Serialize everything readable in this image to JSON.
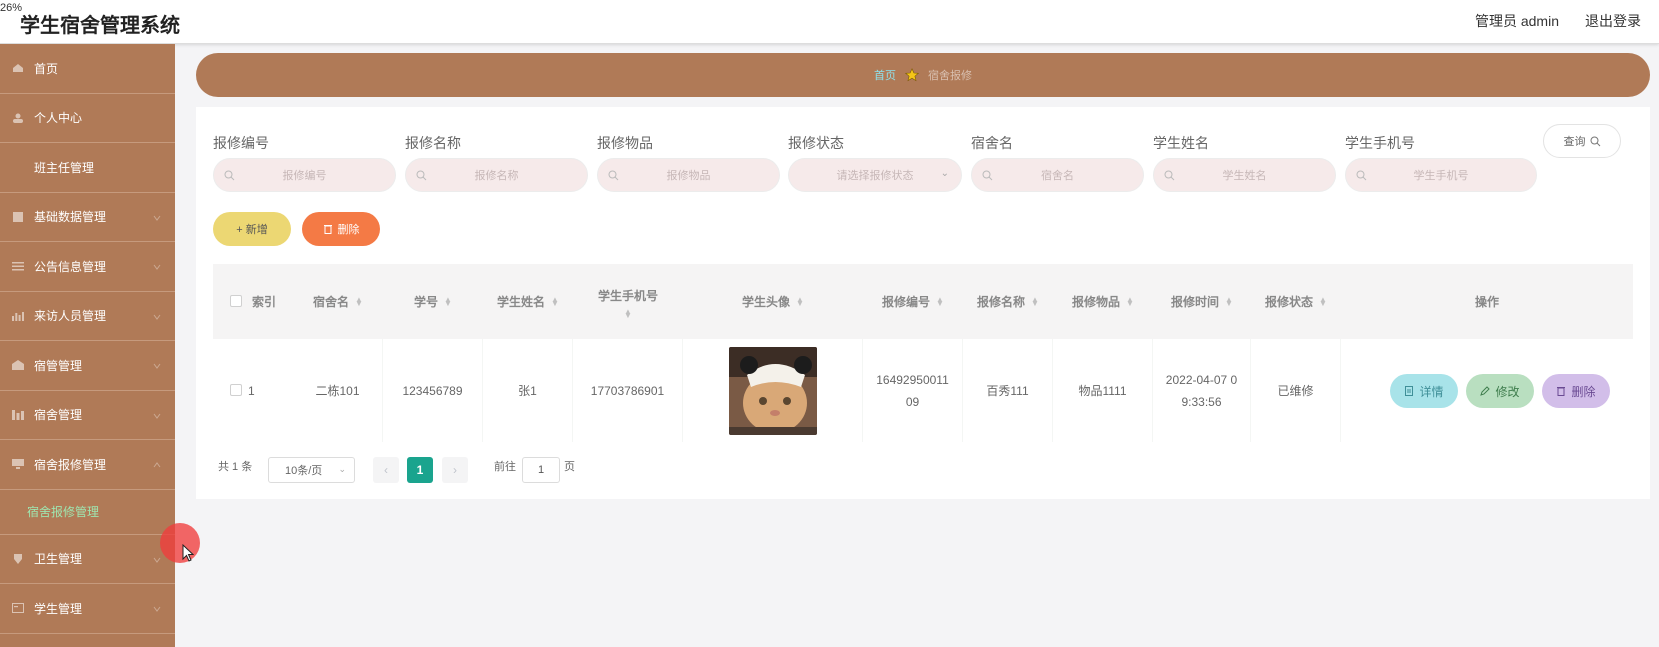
{
  "zoom": "26%",
  "header": {
    "title": "学生宿舍管理系统",
    "user": "管理员 admin",
    "logout": "退出登录"
  },
  "sidebar": {
    "items": [
      {
        "label": "首页",
        "icon": "home-icon"
      },
      {
        "label": "个人中心",
        "icon": "user-icon"
      },
      {
        "label": "班主任管理",
        "icon": ""
      },
      {
        "label": "基础数据管理",
        "icon": "database-icon"
      },
      {
        "label": "公告信息管理",
        "icon": "list-icon"
      },
      {
        "label": "来访人员管理",
        "icon": "chart-icon"
      },
      {
        "label": "宿管管理",
        "icon": "building-icon"
      },
      {
        "label": "宿舍管理",
        "icon": "bars-icon"
      },
      {
        "label": "宿舍报修管理",
        "icon": "monitor-icon"
      }
    ],
    "sub_item": "宿舍报修管理",
    "items_after": [
      {
        "label": "卫生管理",
        "icon": "shield-icon"
      },
      {
        "label": "学生管理",
        "icon": "card-icon"
      }
    ]
  },
  "breadcrumb": {
    "home": "首页",
    "current": "宿舍报修"
  },
  "search": {
    "fields": [
      {
        "label": "报修编号",
        "placeholder": "报修编号"
      },
      {
        "label": "报修名称",
        "placeholder": "报修名称"
      },
      {
        "label": "报修物品",
        "placeholder": "报修物品"
      },
      {
        "label": "报修状态",
        "placeholder": "请选择报修状态"
      },
      {
        "label": "宿舍名",
        "placeholder": "宿舍名"
      },
      {
        "label": "学生姓名",
        "placeholder": "学生姓名"
      },
      {
        "label": "学生手机号",
        "placeholder": "学生手机号"
      }
    ],
    "query_button": "查询"
  },
  "toolbar": {
    "add": "+ 新增",
    "delete": "删除"
  },
  "table": {
    "columns": [
      "索引",
      "宿舍名",
      "学号",
      "学生姓名",
      "学生手机号",
      "学生头像",
      "报修编号",
      "报修名称",
      "报修物品",
      "报修时间",
      "报修状态",
      "操作"
    ],
    "rows": [
      {
        "index": "1",
        "dorm": "二栋101",
        "student_no": "123456789",
        "name": "张1",
        "phone": "17703786901",
        "repair_no": "1649295001109",
        "repair_name": "百秀111",
        "item": "物品1111",
        "time": "2022-04-07 09:33:56",
        "status": "已维修"
      }
    ],
    "actions": {
      "detail": "详情",
      "edit": "修改",
      "delete": "删除"
    }
  },
  "pagination": {
    "total": "共 1 条",
    "page_size": "10条/页",
    "current": "1",
    "goto": "前往",
    "goto_value": "1",
    "page_unit": "页"
  },
  "colors": {
    "sidebar": "#b07a57",
    "accent_green": "#1aa48e",
    "add_btn": "#ecd773",
    "delete_btn": "#f47a45"
  }
}
